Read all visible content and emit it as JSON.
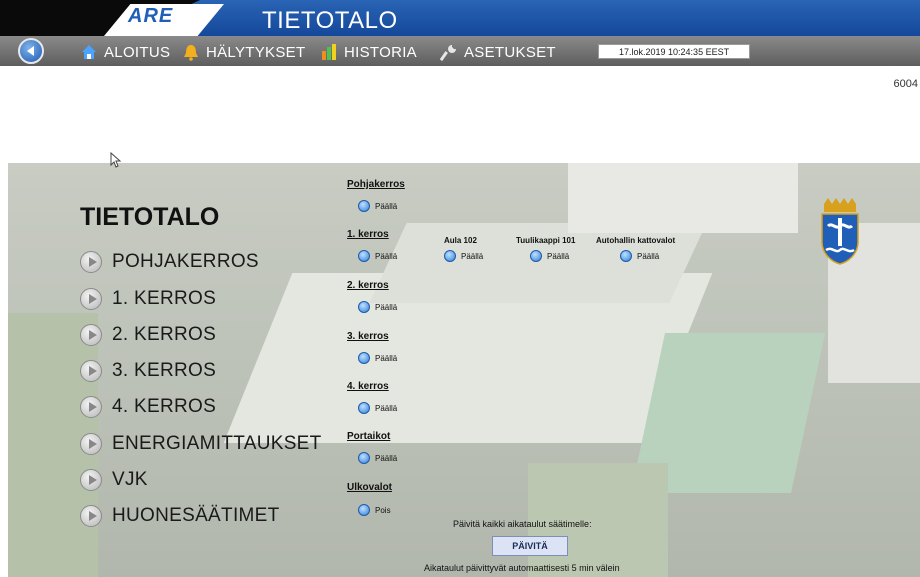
{
  "header": {
    "logo": "ARE",
    "title": "TIETOTALO",
    "datetime": "17.lok.2019 10:24:35 EEST",
    "page_number": "6004"
  },
  "nav": {
    "items": [
      {
        "label": "ALOITUS",
        "icon": "home-icon"
      },
      {
        "label": "HÄLYTYKSET",
        "icon": "bell-icon"
      },
      {
        "label": "HISTORIA",
        "icon": "bar-chart-icon"
      },
      {
        "label": "ASETUKSET",
        "icon": "wrench-icon"
      }
    ]
  },
  "main": {
    "title": "TIETOTALO",
    "menu": [
      "POHJAKERROS",
      "1. KERROS",
      "2. KERROS",
      "3. KERROS",
      "4. KERROS",
      "ENERGIAMITTAUKSET",
      "VJK",
      "HUONESÄÄTIMET"
    ],
    "floors": [
      {
        "label": "Pohjakerros",
        "status": "Päällä"
      },
      {
        "label": "1. kerros",
        "status": "Päällä"
      },
      {
        "label": "2. kerros",
        "status": "Päällä"
      },
      {
        "label": "3. kerros",
        "status": "Päällä"
      },
      {
        "label": "4. kerros",
        "status": "Päällä"
      },
      {
        "label": "Portaikot",
        "status": "Päällä"
      },
      {
        "label": "Ulkovalot",
        "status": "Pois"
      }
    ],
    "extra": [
      {
        "label": "Aula 102",
        "status": "Päällä"
      },
      {
        "label": "Tuulikaappi 101",
        "status": "Päällä"
      },
      {
        "label": "Autohallin kattovalot",
        "status": "Päällä"
      }
    ],
    "refresh": {
      "prompt": "Päivitä kaikki aikataulut säätimelle:",
      "button": "PÄIVITÄ",
      "note": "Aikataulut päivittyvät automaattisesti 5 min välein"
    }
  },
  "colors": {
    "title_bar": "#1f58ab",
    "nav_bar": "#707070",
    "status_on": "#2e7fd8"
  }
}
